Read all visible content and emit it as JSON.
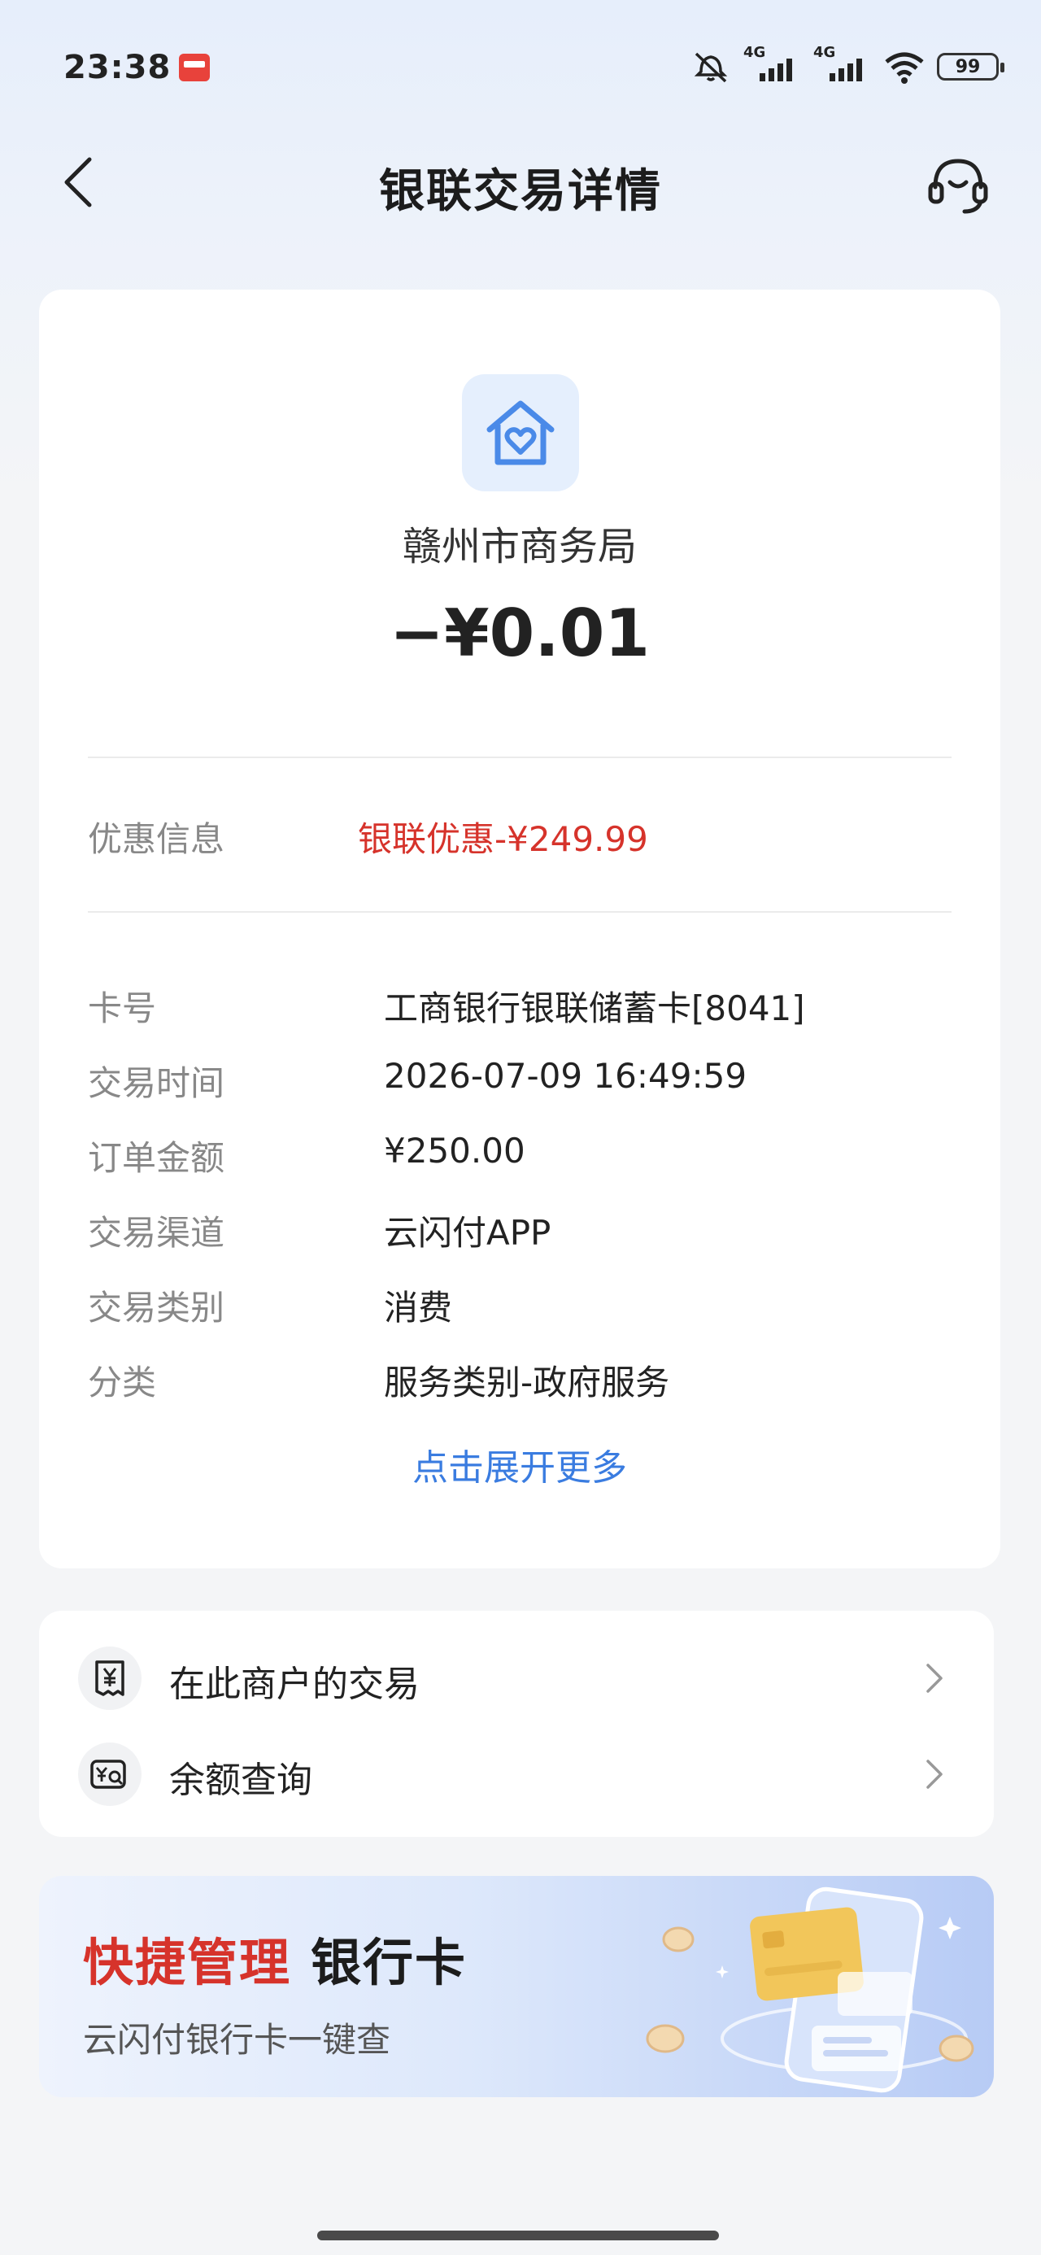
{
  "status_bar": {
    "time": "23:38",
    "signal1_tag": "4G",
    "signal2_tag": "4G",
    "battery": "99"
  },
  "nav": {
    "title": "银联交易详情"
  },
  "transaction": {
    "merchant": "赣州市商务局",
    "amount": "−¥0.01",
    "discount_label": "优惠信息",
    "discount_value": "银联优惠-¥249.99",
    "details": [
      {
        "label": "卡号",
        "value": "工商银行银联储蓄卡[8041]"
      },
      {
        "label": "交易时间",
        "value": "2026-07-09 16:49:59"
      },
      {
        "label": "订单金额",
        "value": "¥250.00"
      },
      {
        "label": "交易渠道",
        "value": "云闪付APP"
      },
      {
        "label": "交易类别",
        "value": "消费"
      },
      {
        "label": "分类",
        "value": "服务类别-政府服务"
      }
    ],
    "expand_more": "点击展开更多"
  },
  "links": [
    {
      "label": "在此商户的交易",
      "icon": "receipt-yen-icon"
    },
    {
      "label": "余额查询",
      "icon": "balance-query-icon"
    }
  ],
  "banner": {
    "title_red": "快捷管理",
    "title_dark": "银行卡",
    "subtitle": "云闪付银行卡一键查"
  },
  "colors": {
    "accent_blue": "#3a7ce0",
    "discount_red": "#d6332b",
    "icon_blue": "#4a8ae8"
  }
}
